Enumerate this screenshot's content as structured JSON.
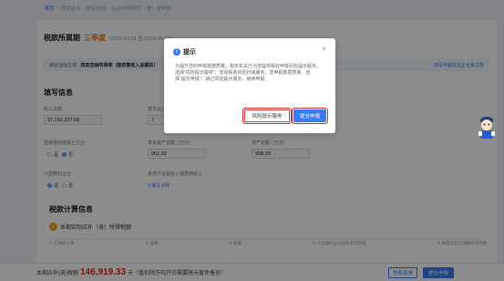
{
  "breadcrumb": {
    "back": "←",
    "items": [
      "首页",
      "我的企业（税定征收）企业所得税月（季）度申报"
    ]
  },
  "period": {
    "title": "税款所属期",
    "quarter": "三季度",
    "dates": "(2023-07-01 至 2023-09-30)"
  },
  "notice": {
    "label": "核定征收方式:",
    "value": "核定应纳所得率（能核算收入总额的）",
    "link": "填写申报情况企业报注意"
  },
  "section_fill": "填写信息",
  "fields": {
    "income_label": "收入总额",
    "income_value": "37,192,237.58",
    "employees_label": "季末从业人数",
    "employees_value": "7",
    "restricted_label": "国家限制或禁止行业",
    "radio_yes": "是",
    "radio_no": "否",
    "assets_label": "季末资产总额（万元）",
    "assets_value": "951.02",
    "avg_assets_label": "资产总额（万元）",
    "avg_assets_value": "958.59",
    "small_label": "小型微利企业",
    "small_yes": "是",
    "small_no": "否",
    "branch_label": "其他不征税收入或费用收入",
    "branch_link": "0  填写说明"
  },
  "section_tax": "税款计算信息",
  "tax_subhead": "本期实际应补（退）所得税额",
  "tax_tabs": [
    "① 应纳税人数",
    "② 减免",
    "③ 税额",
    "④ 小型微利企业减免所得税额",
    "⑤ 本期实际已预缴所得税额"
  ],
  "bottom": {
    "label": "本期应补(退)税额",
    "amount": "146,919.33",
    "suffix": "元（暂扣除万吨开仿需要限元套免备份）",
    "preview_btn": "税务表单",
    "submit_btn": "提交申报"
  },
  "dialog": {
    "title": "提示",
    "close": "×",
    "body": "为提升您的申报数据质量，税务机关已为您提供税收申报风险提示服务。选择\"风险提示服务\"：享受税收风险扫描服务，您申报数据质量。选择\"提交申报\"：跳过风险提示服务，继续申报。",
    "risk_button": "风险提示服务",
    "submit_button": "提交申报"
  },
  "colors": {
    "accent": "#3a7bf2",
    "quarter": "#e67a1e",
    "amount": "#e1251b",
    "highlight": "#c8302c"
  }
}
